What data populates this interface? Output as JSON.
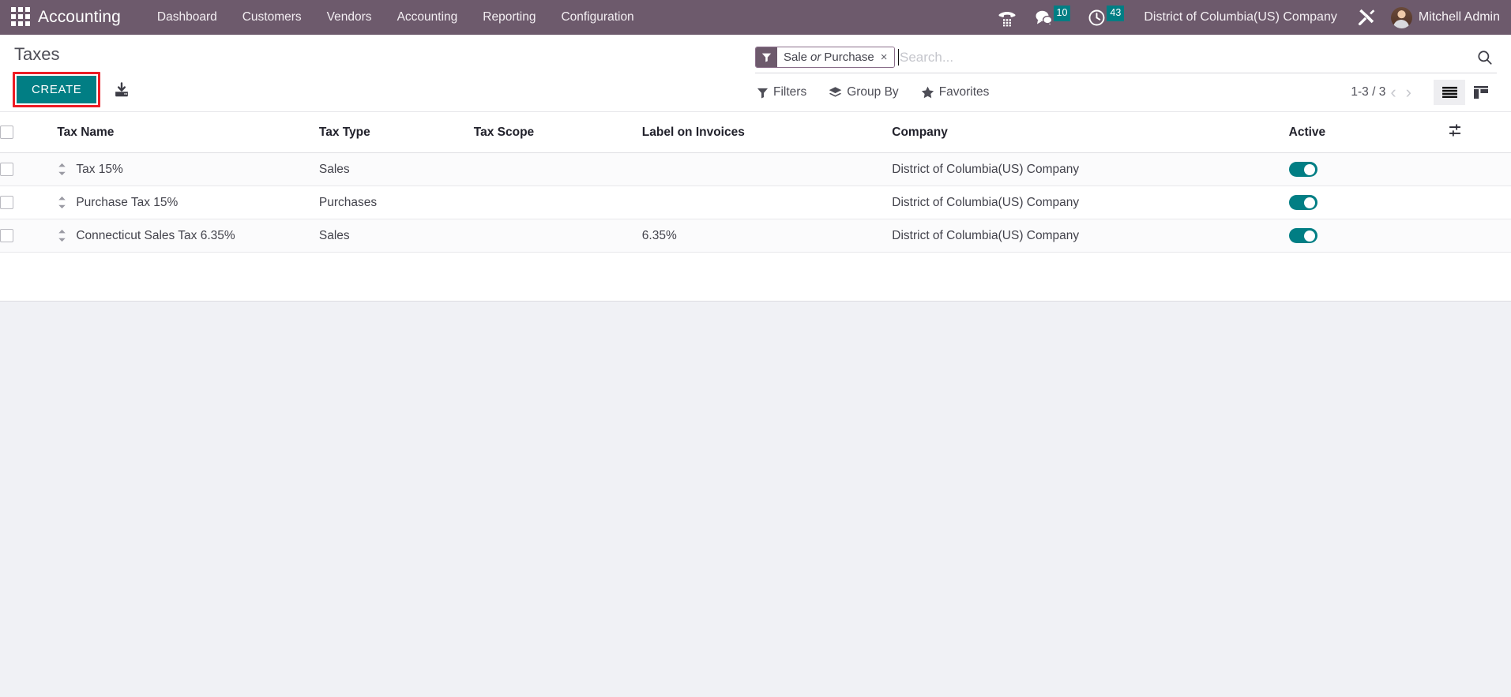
{
  "navbar": {
    "apps_icon": "apps-grid-icon",
    "brand": "Accounting",
    "menu": [
      {
        "label": "Dashboard"
      },
      {
        "label": "Customers"
      },
      {
        "label": "Vendors"
      },
      {
        "label": "Accounting"
      },
      {
        "label": "Reporting"
      },
      {
        "label": "Configuration"
      }
    ],
    "phone_icon": "phone-dialpad-icon",
    "messages": {
      "icon": "chat-bubble-icon",
      "count": "10"
    },
    "activities": {
      "icon": "clock-icon",
      "count": "43"
    },
    "company": "District of Columbia(US) Company",
    "tools_icon": "wrench-screwdriver-icon",
    "avatar": "user-avatar",
    "user": "Mitchell Admin"
  },
  "control_panel": {
    "title": "Taxes",
    "create_label": "CREATE",
    "import_icon": "import-download-icon",
    "search": {
      "facet": {
        "icon": "filter-funnel-icon",
        "prefix": "Sale",
        "conjunction": "or",
        "suffix": "Purchase",
        "remove": "×"
      },
      "placeholder": "Search...",
      "value": "",
      "search_icon": "magnifier-icon"
    },
    "dropdowns": [
      {
        "icon": "filter-funnel-icon",
        "label": "Filters"
      },
      {
        "icon": "layers-icon",
        "label": "Group By"
      },
      {
        "icon": "star-icon",
        "label": "Favorites"
      }
    ],
    "pager": {
      "value": "1-3 / 3",
      "prev": "‹",
      "next": "›"
    },
    "views": [
      {
        "name": "list-view",
        "icon": "list-icon",
        "active": true
      },
      {
        "name": "kanban-view",
        "icon": "kanban-icon",
        "active": false
      }
    ]
  },
  "list": {
    "columns": [
      "Tax Name",
      "Tax Type",
      "Tax Scope",
      "Label on Invoices",
      "Company",
      "Active"
    ],
    "optional_columns_icon": "sliders-icon",
    "rows": [
      {
        "name": "Tax 15%",
        "type": "Sales",
        "scope": "",
        "label_on_invoices": "",
        "company": "District of Columbia(US) Company",
        "active": true
      },
      {
        "name": "Purchase Tax 15%",
        "type": "Purchases",
        "scope": "",
        "label_on_invoices": "",
        "company": "District of Columbia(US) Company",
        "active": true
      },
      {
        "name": "Connecticut Sales Tax 6.35%",
        "type": "Sales",
        "scope": "",
        "label_on_invoices": "6.35%",
        "company": "District of Columbia(US) Company",
        "active": true
      }
    ]
  },
  "colors": {
    "navbar": "#6d5a6c",
    "accent_teal": "#017e84",
    "highlight_red": "#ed1c24",
    "page_bg": "#f0f1f5"
  }
}
